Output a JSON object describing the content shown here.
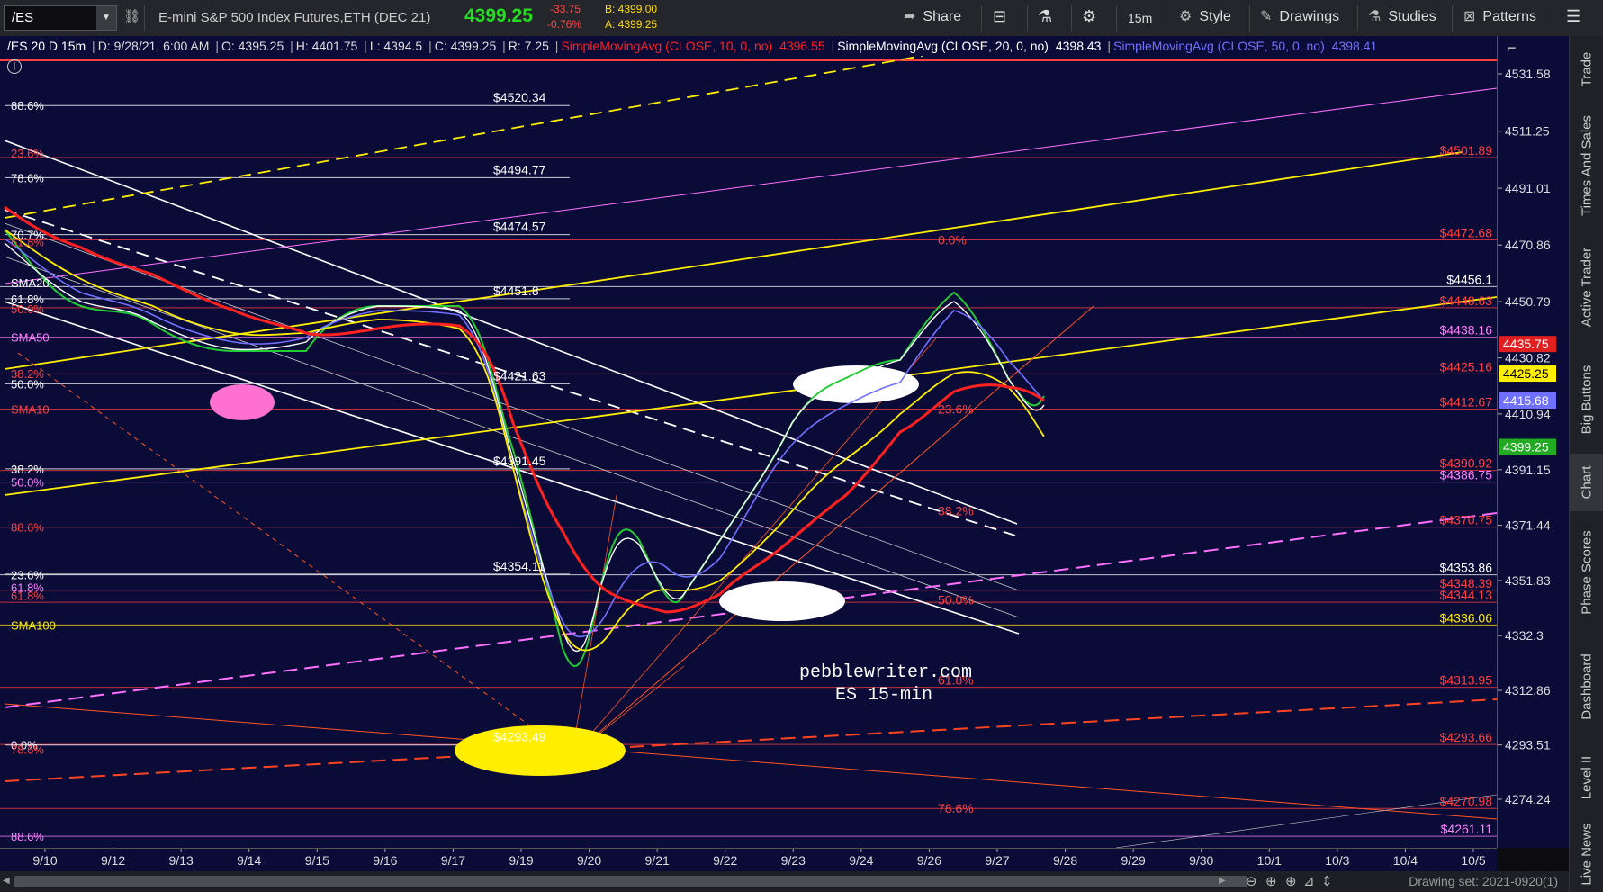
{
  "toolbar": {
    "symbol": "/ES",
    "instrument": "E-mini S&P 500 Index Futures,ETH (DEC 21)",
    "last_price": "4399.25",
    "change": "-33.75",
    "change_pct": "-0.76%",
    "bid": "B: 4399.00",
    "ask": "A: 4399.25",
    "share_label": "Share",
    "interval_label": "15m",
    "style_label": "Style",
    "drawings_label": "Drawings",
    "studies_label": "Studies",
    "patterns_label": "Patterns"
  },
  "header": {
    "title": "/ES 20 D 15m",
    "date": "D: 9/28/21, 6:00 AM",
    "open": "O: 4395.25",
    "high": "H: 4401.75",
    "low": "L: 4394.5",
    "close": "C: 4399.25",
    "range": "R: 7.25",
    "sma10_label": "SimpleMovingAvg (CLOSE, 10, 0, no)",
    "sma10_value": "4396.55",
    "sma20_label": "SimpleMovingAvg (CLOSE, 20, 0, no)",
    "sma20_value": "4398.43",
    "sma50_label": "SimpleMovingAvg (CLOSE, 50, 0, no)",
    "sma50_value": "4398.41"
  },
  "watermark": {
    "line1": "pebblewriter.com",
    "line2": "ES 15-min"
  },
  "sidebar": {
    "tabs": [
      "Trade",
      "Times And Sales",
      "Active Trader",
      "Big Buttons",
      "Chart",
      "Phase Scores",
      "Dashboard",
      "Level II",
      "Live News"
    ],
    "active": "Chart"
  },
  "bottom": {
    "drawing_set": "Drawing set: 2021-0920(1)"
  },
  "chart_data": {
    "type": "line",
    "ylim": [
      4257,
      4545
    ],
    "yticks": [
      4531.58,
      4511.25,
      4491.01,
      4470.86,
      4450.79,
      4430.82,
      4410.94,
      4391.15,
      4371.44,
      4351.83,
      4332.3,
      4312.86,
      4293.51,
      4274.24
    ],
    "xticks": [
      "9/10",
      "9/12",
      "9/13",
      "9/14",
      "9/15",
      "9/16",
      "9/17",
      "9/19",
      "9/20",
      "9/21",
      "9/22",
      "9/23",
      "9/24",
      "9/26",
      "9/27",
      "9/28",
      "9/29",
      "9/30",
      "10/1",
      "10/3",
      "10/4",
      "10/5"
    ],
    "price_badges": [
      {
        "value": "4435.75",
        "color": "#e02020",
        "text_color": "#ffffff"
      },
      {
        "value": "4425.25",
        "color": "#ffee00",
        "text_color": "#000000"
      },
      {
        "value": "4415.68",
        "color": "#7070ff",
        "text_color": "#ffffff"
      },
      {
        "value": "4399.25",
        "color": "#22aa22",
        "text_color": "#ffffff"
      }
    ],
    "right_labels": [
      {
        "text": "$4501.89",
        "y": 4501.89,
        "color": "#ff4040"
      },
      {
        "text": "$4472.68",
        "y": 4472.68,
        "color": "#ff4040"
      },
      {
        "text": "$4456.1",
        "y": 4456.1,
        "color": "#ffffff"
      },
      {
        "text": "$4448.63",
        "y": 4448.63,
        "color": "#ff4040"
      },
      {
        "text": "$4438.16",
        "y": 4438.16,
        "color": "#ff80ff"
      },
      {
        "text": "$4425.16",
        "y": 4425.16,
        "color": "#ff4040"
      },
      {
        "text": "$4412.67",
        "y": 4412.67,
        "color": "#ff4040"
      },
      {
        "text": "$4390.92",
        "y": 4390.92,
        "color": "#ff4040"
      },
      {
        "text": "$4386.75",
        "y": 4386.75,
        "color": "#ff80ff"
      },
      {
        "text": "$4370.75",
        "y": 4370.75,
        "color": "#ff4040"
      },
      {
        "text": "$4353.86",
        "y": 4353.86,
        "color": "#ffffff"
      },
      {
        "text": "$4348.39",
        "y": 4348.39,
        "color": "#ff4040"
      },
      {
        "text": "$4344.13",
        "y": 4344.13,
        "color": "#ff4040"
      },
      {
        "text": "$4336.06",
        "y": 4336.06,
        "color": "#ffee00"
      },
      {
        "text": "$4313.95",
        "y": 4313.95,
        "color": "#ff4040"
      },
      {
        "text": "$4293.66",
        "y": 4293.66,
        "color": "#ff4040"
      },
      {
        "text": "$4270.98",
        "y": 4270.98,
        "color": "#ff4040"
      },
      {
        "text": "$4261.11",
        "y": 4261.11,
        "color": "#ff80ff"
      }
    ],
    "mid_labels": [
      {
        "text": "$4520.34",
        "y": 4520.34
      },
      {
        "text": "$4494.77",
        "y": 4494.77
      },
      {
        "text": "$4474.57",
        "y": 4474.57
      },
      {
        "text": "$4451.8",
        "y": 4451.8
      },
      {
        "text": "$4421.63",
        "y": 4421.63
      },
      {
        "text": "$4391.45",
        "y": 4391.45
      },
      {
        "text": "$4354.11",
        "y": 4354.11
      },
      {
        "text": "$4293.49",
        "y": 4293.49
      }
    ],
    "left_labels": [
      {
        "text": "88.6%",
        "y": 4520.34,
        "color": "#ffffff"
      },
      {
        "text": "23.6%",
        "y": 4503.5,
        "color": "#ff4040"
      },
      {
        "text": "78.6%",
        "y": 4494.77,
        "color": "#ffffff"
      },
      {
        "text": "70.7%",
        "y": 4474.57,
        "color": "#ffffff"
      },
      {
        "text": "61.8%",
        "y": 4472.0,
        "color": "#ff4040"
      },
      {
        "text": "SMA20",
        "y": 4457.5,
        "color": "#ffffff"
      },
      {
        "text": "61.8%",
        "y": 4451.8,
        "color": "#ffffff"
      },
      {
        "text": "50.0%",
        "y": 4448.3,
        "color": "#ff4040"
      },
      {
        "text": "SMA50",
        "y": 4438.2,
        "color": "#ff80ff"
      },
      {
        "text": "38.2%",
        "y": 4425.3,
        "color": "#ff4040"
      },
      {
        "text": "50.0%",
        "y": 4421.63,
        "color": "#ffffff"
      },
      {
        "text": "SMA10",
        "y": 4412.7,
        "color": "#ff4040"
      },
      {
        "text": "38.2%",
        "y": 4391.45,
        "color": "#ffffff"
      },
      {
        "text": "50.0%",
        "y": 4386.75,
        "color": "#ff80ff"
      },
      {
        "text": "88.6%",
        "y": 4370.75,
        "color": "#ff4040"
      },
      {
        "text": "23.6%",
        "y": 4353.86,
        "color": "#ffffff"
      },
      {
        "text": "61.8%",
        "y": 4349.5,
        "color": "#ff80ff"
      },
      {
        "text": "61.8%",
        "y": 4346.5,
        "color": "#ff4040"
      },
      {
        "text": "SMA100",
        "y": 4336.06,
        "color": "#ffee00"
      },
      {
        "text": "0.0%",
        "y": 4293.49,
        "color": "#ffffff"
      },
      {
        "text": "78.6%",
        "y": 4292.0,
        "color": "#ff4040"
      },
      {
        "text": "88.6%",
        "y": 4261.11,
        "color": "#ff80ff"
      }
    ],
    "fib_labels": [
      {
        "text": "0.0%",
        "y": 4472.68
      },
      {
        "text": "23.6%",
        "y": 4412.67
      },
      {
        "text": "38.2%",
        "y": 4376.5
      },
      {
        "text": "50.0%",
        "y": 4345.0
      },
      {
        "text": "61.8%",
        "y": 4316.5
      },
      {
        "text": "78.6%",
        "y": 4270.98
      }
    ],
    "series": [
      {
        "name": "SMA10",
        "color": "#ff2020"
      },
      {
        "name": "SMA20",
        "color": "#ffffff"
      },
      {
        "name": "SMA50",
        "color": "#7070ff"
      }
    ]
  }
}
